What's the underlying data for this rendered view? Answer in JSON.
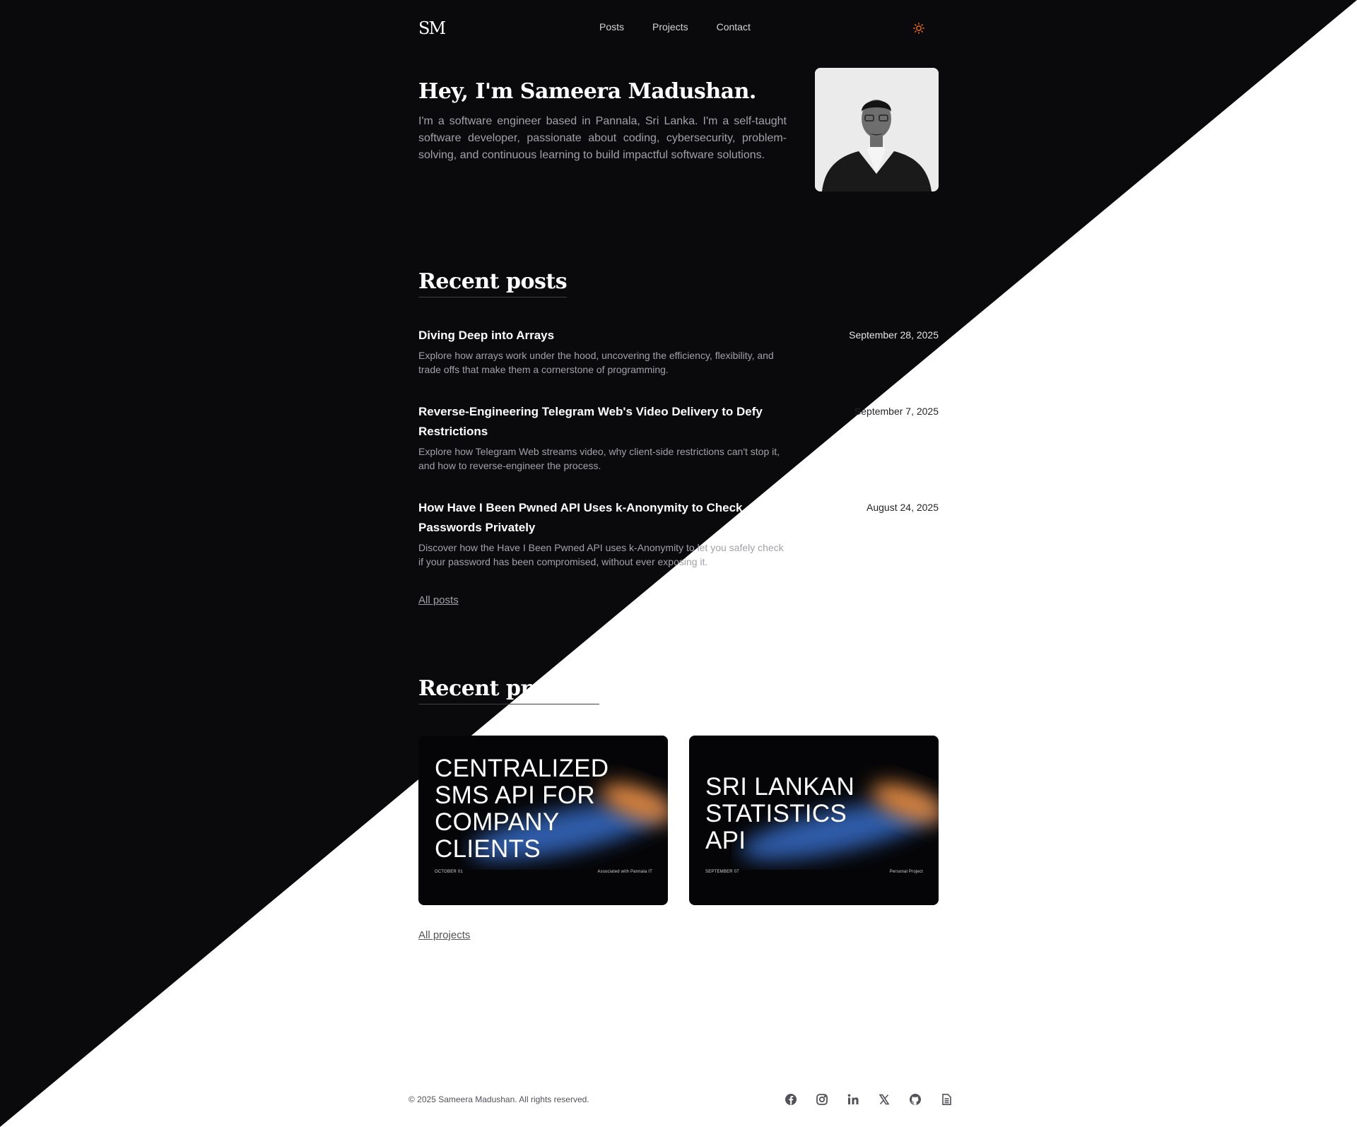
{
  "header": {
    "logo": "SM",
    "nav": [
      "Posts",
      "Projects",
      "Contact"
    ],
    "theme_icon": "sun-icon",
    "theme_color": "#f97316"
  },
  "hero": {
    "title": "Hey, I'm Sameera Madushan.",
    "description": "I'm a software engineer based in Pannala, Sri Lanka. I'm a self-taught software developer, passionate about coding, cybersecurity, problem-solving, and continuous learning to build impactful software solutions."
  },
  "posts": {
    "heading": "Recent posts",
    "items": [
      {
        "title": "Diving Deep into Arrays",
        "description": "Explore how arrays work under the hood, uncovering the efficiency, flexibility, and trade offs that make them a cornerstone of programming.",
        "date": "September 28, 2025"
      },
      {
        "title": "Reverse-Engineering Telegram Web's Video Delivery to Defy Restrictions",
        "description": "Explore how Telegram Web streams video, why client-side restrictions can't stop it, and how to reverse-engineer the process.",
        "date": "September 7, 2025"
      },
      {
        "title": "How Have I Been Pwned API Uses k-Anonymity to Check Passwords Privately",
        "description": "Discover how the Have I Been Pwned API uses k-Anonymity to let you safely check if your password has been compromised, without ever exposing it.",
        "date": "August 24, 2025"
      }
    ],
    "more_label": "All posts"
  },
  "projects": {
    "heading": "Recent projects",
    "items": [
      {
        "title": "CENTRALIZED SMS API FOR COMPANY CLIENTS",
        "date": "OCTOBER 01",
        "tag": "Associated with Pannala IT"
      },
      {
        "title": "SRI LANKAN STATISTICS API",
        "date": "SEPTEMBER 07",
        "tag": "Personal Project"
      }
    ],
    "more_label": "All projects"
  },
  "footer": {
    "copyright": "© 2025 Sameera Madushan. All rights reserved.",
    "socials": [
      "facebook-icon",
      "instagram-icon",
      "linkedin-icon",
      "x-icon",
      "github-icon",
      "document-icon"
    ]
  }
}
